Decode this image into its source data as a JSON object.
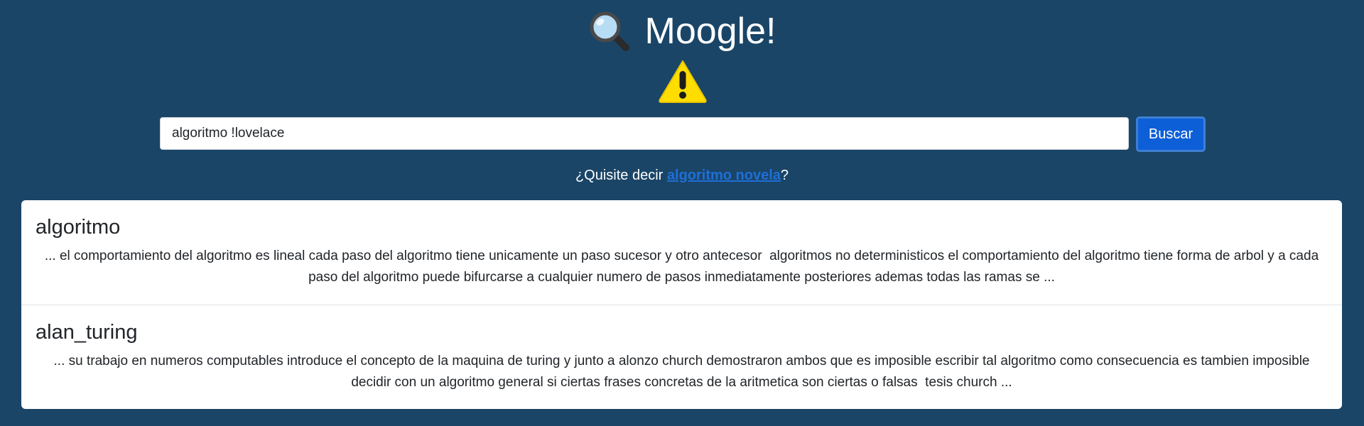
{
  "app": {
    "title": "Moogle!",
    "logo_icon": "magnifying-glass-icon",
    "warning_icon": "warning-icon"
  },
  "search": {
    "query": "algoritmo !lovelace",
    "button_label": "Buscar"
  },
  "suggestion": {
    "prefix": "¿Quisite decir ",
    "link_text": "algoritmo novela",
    "suffix": "?"
  },
  "results": [
    {
      "title": "algoritmo",
      "snippet": "... el comportamiento del algoritmo es lineal cada paso del algoritmo tiene unicamente un paso sucesor y otro antecesor  algoritmos no deterministicos el comportamiento del algoritmo tiene forma de arbol y a cada paso del algoritmo puede bifurcarse a cualquier numero de pasos inmediatamente posteriores ademas todas las ramas se ..."
    },
    {
      "title": "alan_turing",
      "snippet": "... su trabajo en numeros computables introduce el concepto de la maquina de turing y junto a alonzo church demostraron ambos que es imposible escribir tal algoritmo como consecuencia es tambien imposible decidir con un algoritmo general si ciertas frases concretas de la aritmetica son ciertas o falsas  tesis church ..."
    }
  ],
  "colors": {
    "background": "#1a4567",
    "button": "#0d5fd8",
    "link": "#1e6fd8",
    "warning": "#ffdd00"
  }
}
